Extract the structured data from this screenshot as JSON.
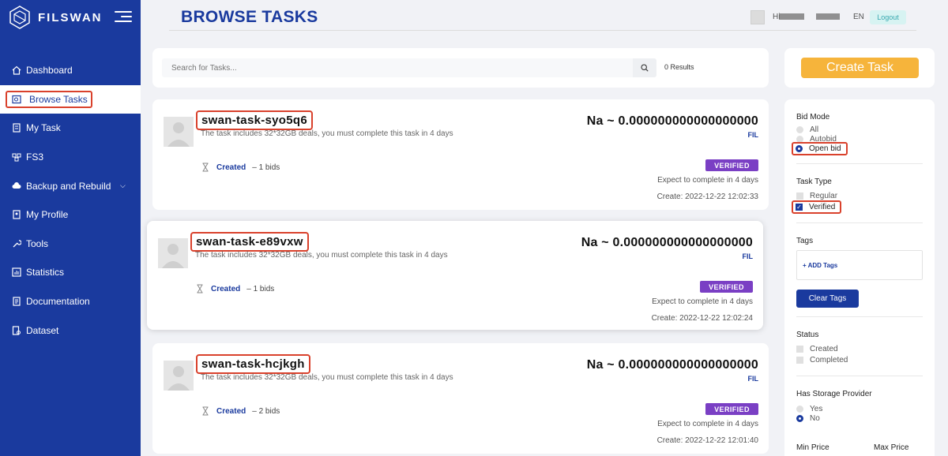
{
  "sidebar": {
    "brand": "FILSWAN",
    "items": [
      {
        "label": "Dashboard",
        "icon": "home-icon"
      },
      {
        "label": "Browse Tasks",
        "icon": "browse-icon",
        "active": true
      },
      {
        "label": "My Task",
        "icon": "task-icon"
      },
      {
        "label": "FS3",
        "icon": "fs3-icon"
      },
      {
        "label": "Backup and Rebuild",
        "icon": "cloud-icon",
        "has_submenu": true
      },
      {
        "label": "My Profile",
        "icon": "profile-icon"
      },
      {
        "label": "Tools",
        "icon": "tools-icon"
      },
      {
        "label": "Statistics",
        "icon": "statistics-icon"
      },
      {
        "label": "Documentation",
        "icon": "documentation-icon"
      },
      {
        "label": "Dataset",
        "icon": "dataset-icon"
      }
    ]
  },
  "header": {
    "title": "BROWSE TASKS",
    "user_prefix": "Hi",
    "language": "EN",
    "logout_label": "Logout"
  },
  "search": {
    "placeholder": "Search for Tasks...",
    "results": "0 Results"
  },
  "tasks": [
    {
      "name": "swan-task-syo5q6",
      "description": "The task includes 32*32GB deals, you must complete this task in 4 days",
      "status": "Created",
      "bids": "– 1 bids",
      "price": "Na ~ 0.000000000000000000",
      "currency": "FIL",
      "badge": "VERIFIED",
      "expect": "Expect to complete in 4 days",
      "created": "Create: 2022-12-22 12:02:33"
    },
    {
      "name": "swan-task-e89vxw",
      "description": "The task includes 32*32GB deals, you must complete this task in 4 days",
      "status": "Created",
      "bids": "– 1 bids",
      "price": "Na ~ 0.000000000000000000",
      "currency": "FIL",
      "badge": "VERIFIED",
      "expect": "Expect to complete in 4 days",
      "created": "Create: 2022-12-22 12:02:24"
    },
    {
      "name": "swan-task-hcjkgh",
      "description": "The task includes 32*32GB deals, you must complete this task in 4 days",
      "status": "Created",
      "bids": "– 2 bids",
      "price": "Na ~ 0.000000000000000000",
      "currency": "FIL",
      "badge": "VERIFIED",
      "expect": "Expect to complete in 4 days",
      "created": "Create: 2022-12-22 12:01:40"
    }
  ],
  "panel": {
    "create_label": "Create Task",
    "bid_mode": {
      "title": "Bid Mode",
      "options": [
        "All",
        "Autobid",
        "Open bid"
      ],
      "selected": "Open bid"
    },
    "task_type": {
      "title": "Task Type",
      "options": [
        "Regular",
        "Verified"
      ],
      "checked": "Verified"
    },
    "tags": {
      "title": "Tags",
      "add_label": "+ ADD Tags"
    },
    "clear_label": "Clear Tags",
    "status": {
      "title": "Status",
      "options": [
        "Created",
        "Completed"
      ]
    },
    "storage_provider": {
      "title": "Has Storage Provider",
      "options": [
        "Yes",
        "No"
      ],
      "selected": "No"
    },
    "min_price": "Min Price",
    "max_price": "Max Price"
  },
  "colors": {
    "sidebar": "#1a3a9e",
    "accent": "#1a3a9e",
    "create_button": "#f6b43b",
    "badge": "#7a3fc4",
    "highlight": "#d9412c"
  }
}
